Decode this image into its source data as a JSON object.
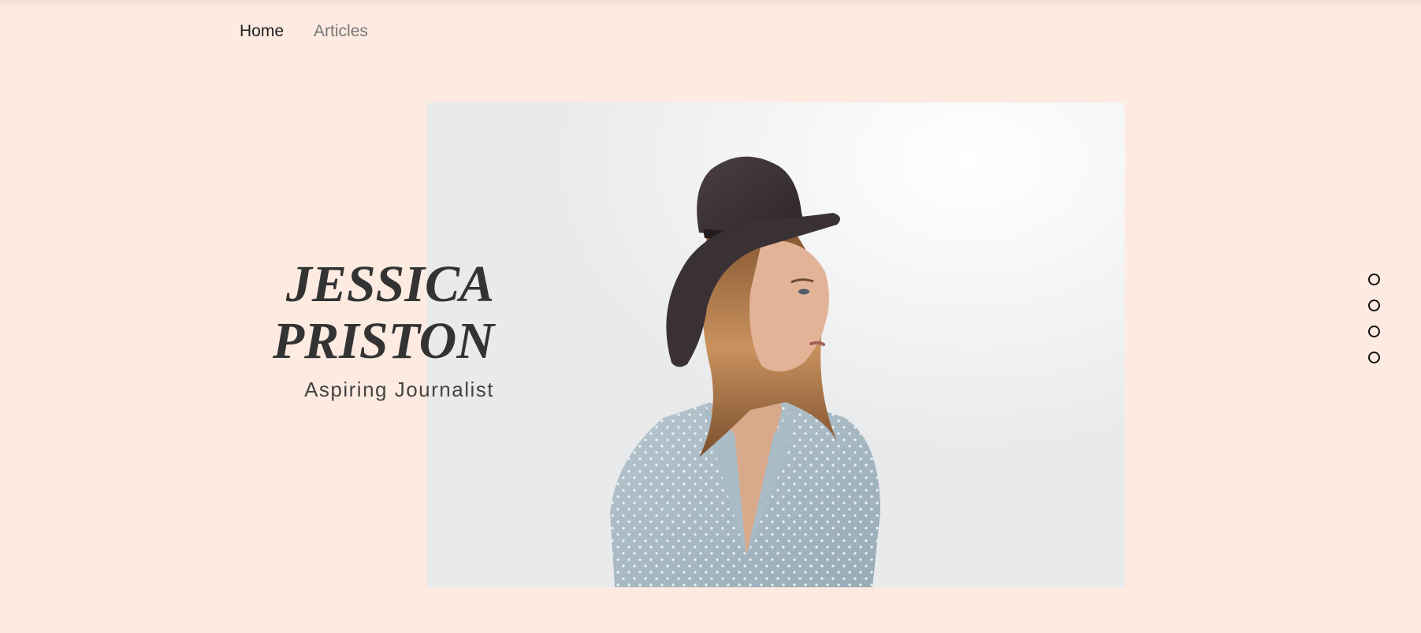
{
  "nav": {
    "items": [
      {
        "label": "Home",
        "active": true
      },
      {
        "label": "Articles",
        "active": false
      }
    ]
  },
  "hero": {
    "name_line1": "JESSICA",
    "name_line2": "PRISTON",
    "subtitle": "Aspiring Journalist"
  },
  "section_dots": {
    "count": 4
  },
  "colors": {
    "background": "#fdebe1",
    "text_dark": "#333333",
    "nav_inactive": "#777777",
    "dot_border": "#111111"
  },
  "icons": {
    "section_dot": "circle-outline-icon"
  }
}
